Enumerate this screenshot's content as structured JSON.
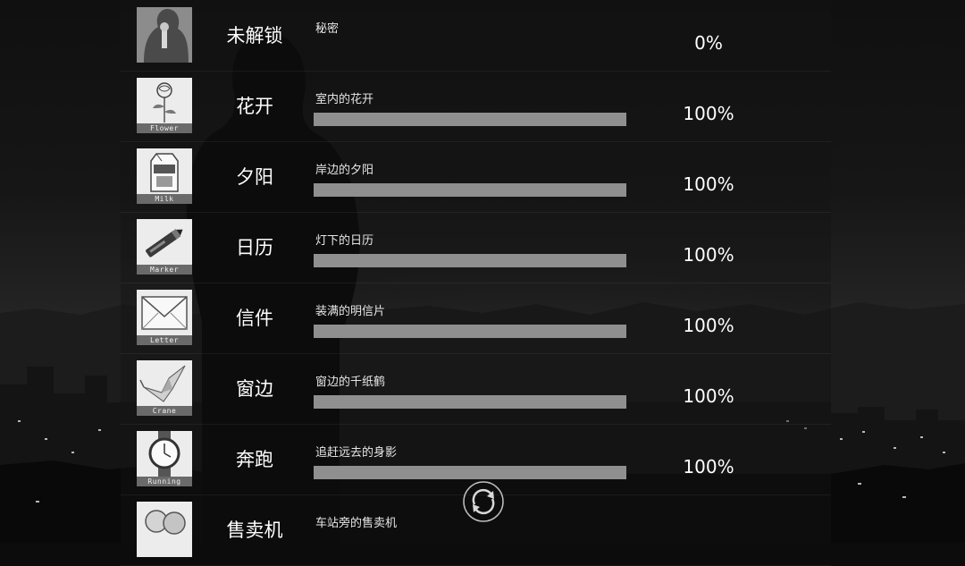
{
  "achievements": [
    {
      "thumb_label": "",
      "name": "未解锁",
      "desc": "秘密",
      "progress": 0,
      "percent": "0%",
      "locked": true,
      "icon": "secret-icon"
    },
    {
      "thumb_label": "Flower",
      "name": "花开",
      "desc": "室内的花开",
      "progress": 1,
      "percent": "100%",
      "locked": false,
      "icon": "flower-icon"
    },
    {
      "thumb_label": "Milk",
      "name": "夕阳",
      "desc": "岸边的夕阳",
      "progress": 1,
      "percent": "100%",
      "locked": false,
      "icon": "milk-carton-icon"
    },
    {
      "thumb_label": "Marker",
      "name": "日历",
      "desc": "灯下的日历",
      "progress": 1,
      "percent": "100%",
      "locked": false,
      "icon": "marker-icon"
    },
    {
      "thumb_label": "Letter",
      "name": "信件",
      "desc": "装满的明信片",
      "progress": 1,
      "percent": "100%",
      "locked": false,
      "icon": "letter-icon"
    },
    {
      "thumb_label": "Crane",
      "name": "窗边",
      "desc": "窗边的千纸鹤",
      "progress": 1,
      "percent": "100%",
      "locked": false,
      "icon": "paper-crane-icon"
    },
    {
      "thumb_label": "Running",
      "name": "奔跑",
      "desc": "追赶远去的身影",
      "progress": 1,
      "percent": "100%",
      "locked": false,
      "icon": "watch-icon"
    },
    {
      "thumb_label": "",
      "name": "售卖机",
      "desc": "车站旁的售卖机",
      "progress": null,
      "percent": "",
      "locked": false,
      "icon": "coins-icon"
    }
  ],
  "controls": {
    "refresh_icon": "refresh-icon"
  },
  "colors": {
    "bar": "#8a8a8a",
    "text": "#ffffff"
  }
}
